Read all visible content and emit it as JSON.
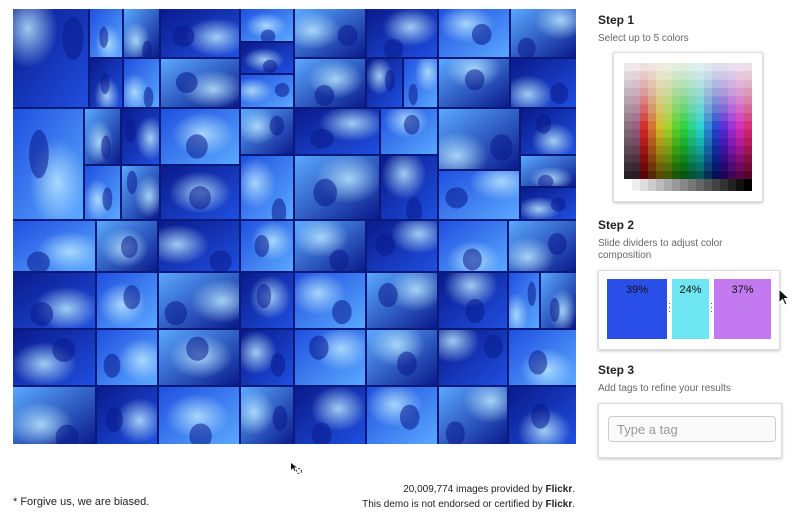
{
  "steps": {
    "step1": {
      "title": "Step 1",
      "subtitle": "Select up to 5 colors"
    },
    "step2": {
      "title": "Step 2",
      "subtitle": "Slide dividers to adjust color composition"
    },
    "step3": {
      "title": "Step 3",
      "subtitle": "Add tags to refine your results"
    }
  },
  "composition": [
    {
      "percent": "39%",
      "fraction": 0.39,
      "color": "#2a4ee8"
    },
    {
      "percent": "24%",
      "fraction": 0.24,
      "color": "#6ee7f2"
    },
    {
      "percent": "37%",
      "fraction": 0.37,
      "color": "#c37af0"
    }
  ],
  "tag_input": {
    "placeholder": "Type a tag",
    "value": ""
  },
  "footer": {
    "footnote": "* Forgive us, we are biased.",
    "count_value": "20,009,774",
    "count_text": " images provided by ",
    "provider": "Flickr",
    "period": ".",
    "disclaimer_text": "This demo is not endorsed or certified by ",
    "disclaimer_provider": "Flickr",
    "disclaimer_period": "."
  },
  "colors": {
    "photo_dark": "#0a1a8c",
    "photo_mid": "#1f4fe0",
    "photo_light": "#5aa8ff",
    "photo_glow": "#b8e6ff"
  }
}
